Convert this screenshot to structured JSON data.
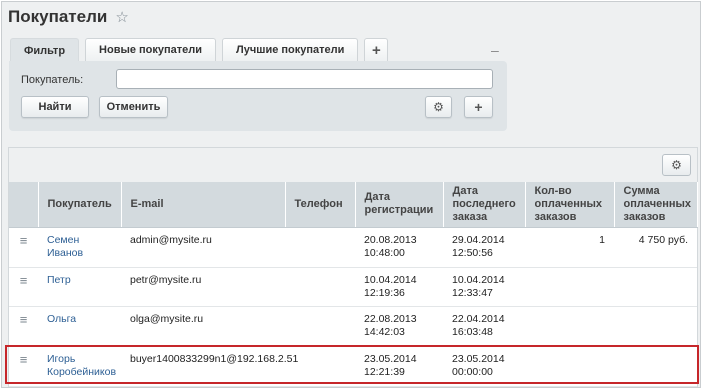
{
  "page": {
    "title": "Покупатели",
    "favorite_icon": "star-icon"
  },
  "tabs": [
    {
      "label": "Фильтр",
      "active": true
    },
    {
      "label": "Новые покупатели",
      "active": false
    },
    {
      "label": "Лучшие покупатели",
      "active": false
    },
    {
      "label": "+",
      "active": false
    }
  ],
  "filter": {
    "buyer_label": "Покупатель:",
    "buyer_value": "",
    "find_label": "Найти",
    "cancel_label": "Отменить",
    "collapse_label": "–",
    "add_label": "+"
  },
  "grid": {
    "columns": [
      "",
      "Покупатель",
      "E-mail",
      "Телефон",
      "Дата регистрации",
      "Дата последнего заказа",
      "Кол-во оплаченных заказов",
      "Сумма оплаченных заказов"
    ],
    "rows": [
      {
        "name": "Семен Иванов",
        "email": "admin@mysite.ru",
        "phone": "",
        "reg_date": "20.08.2013",
        "reg_time": "10:48:00",
        "last_date": "29.04.2014",
        "last_time": "12:50:56",
        "paid_count": "1",
        "paid_sum": "4 750 руб."
      },
      {
        "name": "Петр",
        "email": "petr@mysite.ru",
        "phone": "",
        "reg_date": "10.04.2014",
        "reg_time": "12:19:36",
        "last_date": "10.04.2014",
        "last_time": "12:33:47",
        "paid_count": "",
        "paid_sum": ""
      },
      {
        "name": "Ольга",
        "email": "olga@mysite.ru",
        "phone": "",
        "reg_date": "22.08.2013",
        "reg_time": "14:42:03",
        "last_date": "22.04.2014",
        "last_time": "16:03:48",
        "paid_count": "",
        "paid_sum": ""
      },
      {
        "name": "Игорь Коробейников",
        "email": "buyer1400833299n1@192.168.2.51",
        "phone": "",
        "reg_date": "23.05.2014",
        "reg_time": "12:21:39",
        "last_date": "23.05.2014",
        "last_time": "00:00:00",
        "paid_count": "",
        "paid_sum": ""
      }
    ],
    "row_menu_icon": "hamburger-icon",
    "settings_icon": "gear-icon"
  },
  "colors": {
    "highlight": "#c6262a",
    "link": "#2d5f94",
    "header_bg": "#d3dade"
  }
}
